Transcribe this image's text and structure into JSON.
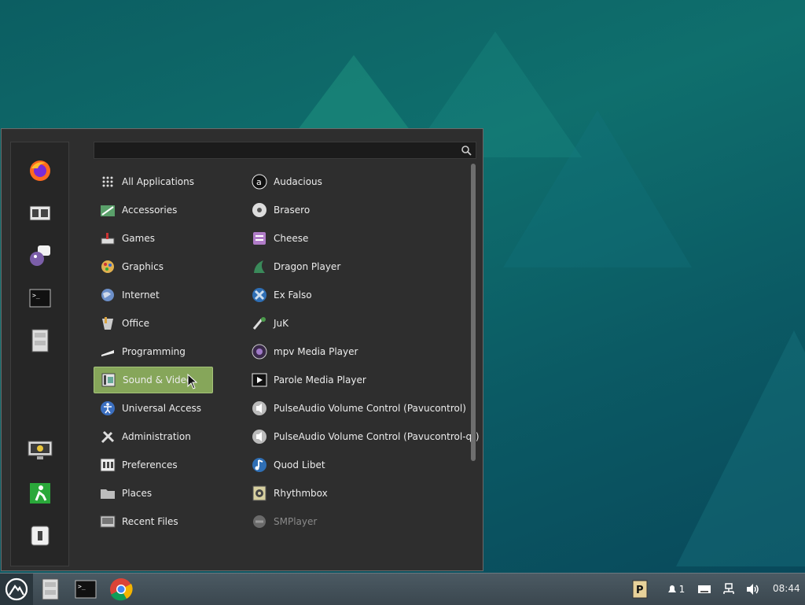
{
  "search": {
    "placeholder": "",
    "value": ""
  },
  "favorites": [
    {
      "name": "firefox-icon"
    },
    {
      "name": "file-manager-icon"
    },
    {
      "name": "pidgin-icon"
    },
    {
      "name": "terminal-icon"
    },
    {
      "name": "file-cabinet-icon"
    },
    {
      "name": "lock-screen-icon"
    },
    {
      "name": "logout-icon"
    },
    {
      "name": "shutdown-icon"
    }
  ],
  "categories": [
    {
      "label": "All Applications",
      "icon": "grid-icon"
    },
    {
      "label": "Accessories",
      "icon": "accessories-icon"
    },
    {
      "label": "Games",
      "icon": "games-icon"
    },
    {
      "label": "Graphics",
      "icon": "graphics-icon"
    },
    {
      "label": "Internet",
      "icon": "internet-icon"
    },
    {
      "label": "Office",
      "icon": "office-icon"
    },
    {
      "label": "Programming",
      "icon": "programming-icon"
    },
    {
      "label": "Sound & Video",
      "icon": "sound-video-icon",
      "active": true
    },
    {
      "label": "Universal Access",
      "icon": "universal-access-icon"
    },
    {
      "label": "Administration",
      "icon": "administration-icon"
    },
    {
      "label": "Preferences",
      "icon": "preferences-icon"
    },
    {
      "label": "Places",
      "icon": "places-icon"
    },
    {
      "label": "Recent Files",
      "icon": "recent-files-icon"
    }
  ],
  "apps": [
    {
      "label": "Audacious",
      "icon": "audacious-icon"
    },
    {
      "label": "Brasero",
      "icon": "brasero-icon"
    },
    {
      "label": "Cheese",
      "icon": "cheese-icon"
    },
    {
      "label": "Dragon Player",
      "icon": "dragon-player-icon"
    },
    {
      "label": "Ex Falso",
      "icon": "ex-falso-icon"
    },
    {
      "label": "JuK",
      "icon": "juk-icon"
    },
    {
      "label": "mpv Media Player",
      "icon": "mpv-icon"
    },
    {
      "label": "Parole Media Player",
      "icon": "parole-icon"
    },
    {
      "label": "PulseAudio Volume Control (Pavucontrol)",
      "icon": "pavucontrol-icon"
    },
    {
      "label": "PulseAudio Volume Control (Pavucontrol-qt)",
      "icon": "pavucontrol-qt-icon"
    },
    {
      "label": "Quod Libet",
      "icon": "quod-libet-icon"
    },
    {
      "label": "Rhythmbox",
      "icon": "rhythmbox-icon"
    },
    {
      "label": "SMPlayer",
      "icon": "smplayer-icon",
      "dim": true
    }
  ],
  "taskbar": {
    "tray": {
      "notifications_count": "1",
      "clock": "08:44"
    }
  },
  "colors": {
    "active_category": "#86a65a",
    "menu_bg": "#2e2e2e",
    "taskbar": "#44525a"
  }
}
